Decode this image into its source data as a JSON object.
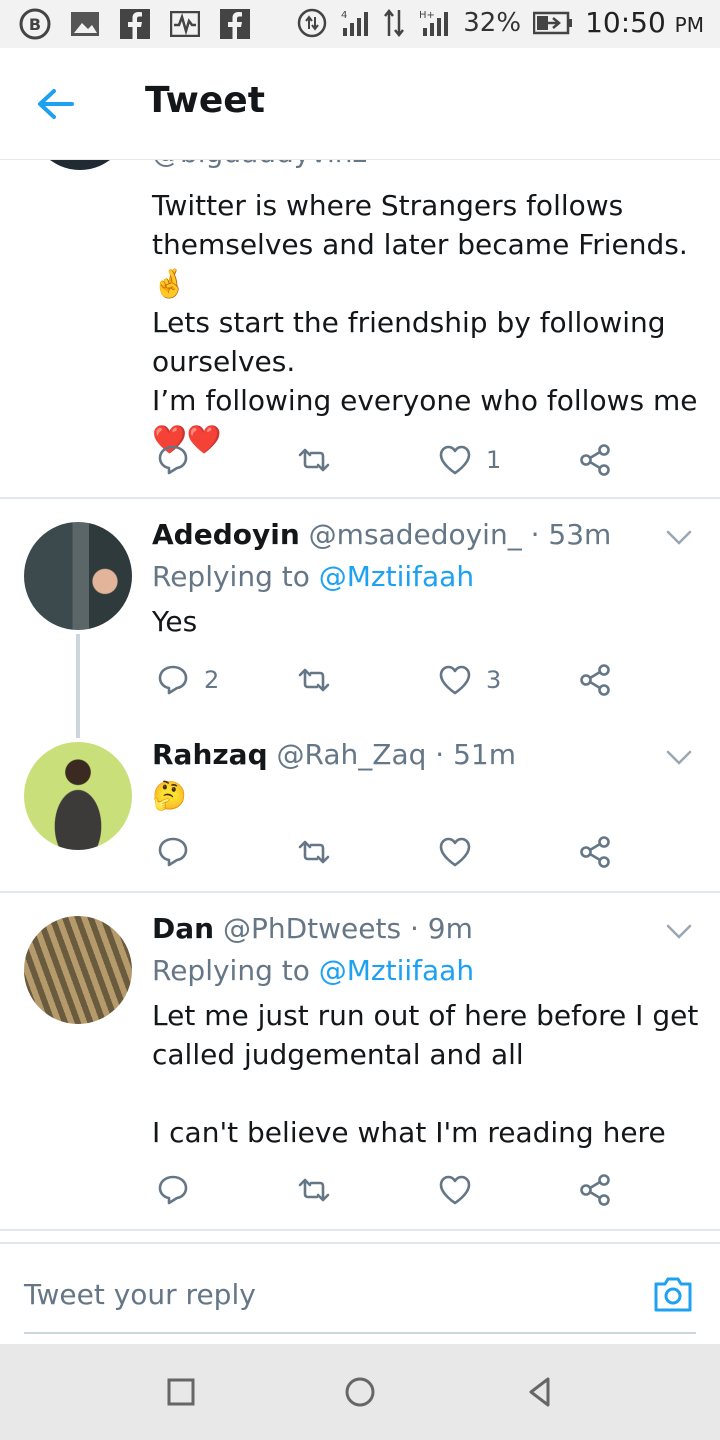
{
  "status_bar": {
    "battery": "32%",
    "time": "10:50",
    "ampm": "PM",
    "network_labels": [
      "4",
      "H+"
    ]
  },
  "header": {
    "title": "Tweet"
  },
  "clipped_tweet": {
    "handle": "@bigdaddyvinz",
    "text_lines": [
      "Twitter is where Strangers follows",
      "themselves and later became Friends. 🤞",
      "Lets start the friendship by following",
      "ourselves.",
      "I’m following everyone who follows me",
      "❤️❤️"
    ],
    "likes": "1"
  },
  "replies": [
    {
      "name": "Adedoyin",
      "handle": "@msadedoyin_",
      "time": "· 53m",
      "replying_prefix": "Replying to",
      "replying_to": "@Mztiifaah",
      "text": "Yes",
      "replies_count": "2",
      "likes": "3"
    },
    {
      "name": "Rahzaq",
      "handle": "@Rah_Zaq",
      "time": "· 51m",
      "text": "🤔"
    },
    {
      "name": "Dan",
      "handle": "@PhDtweets",
      "time": "· 9m",
      "replying_prefix": "Replying to",
      "replying_to": "@Mztiifaah",
      "text_lines": [
        "Let me just run out of here before I get",
        "called judgemental and all",
        "",
        "I can't believe what I'm reading here"
      ]
    }
  ],
  "reply_bar": {
    "placeholder": "Tweet your reply"
  },
  "colors": {
    "accent": "#1da1f2",
    "muted": "#657786",
    "like_red": "#e0245e"
  },
  "icons": [
    "back-arrow-icon",
    "reply-icon",
    "retweet-icon",
    "like-icon",
    "share-icon",
    "chevron-down-icon",
    "camera-icon"
  ]
}
